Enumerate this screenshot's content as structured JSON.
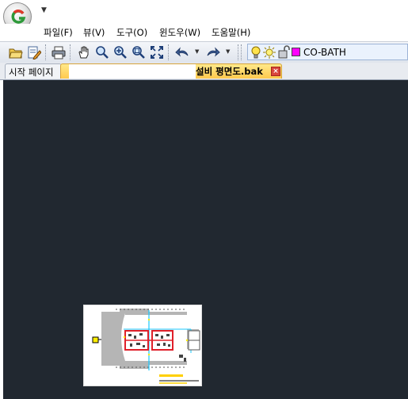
{
  "menubar": {
    "items": [
      "파일(F)",
      "뷰(V)",
      "도구(O)",
      "윈도우(W)",
      "도움말(H)"
    ]
  },
  "toolbar": {
    "icons": [
      "open-folder-icon",
      "edit-icon",
      "print-icon",
      "pan-hand-icon",
      "zoom-icon",
      "zoom-in-icon",
      "zoom-window-icon",
      "zoom-extents-icon",
      "undo-icon",
      "redo-icon",
      "lightbulb-icon",
      "sun-icon",
      "lock-icon"
    ],
    "current_layer": {
      "name": "CO-BATH",
      "color": "#ff00ff"
    }
  },
  "tabs": {
    "start_page": "시작 페이지",
    "document": "설비 평면도.bak"
  },
  "colors": {
    "canvas_background": "#212830",
    "active_tab": "#ffd25c"
  }
}
